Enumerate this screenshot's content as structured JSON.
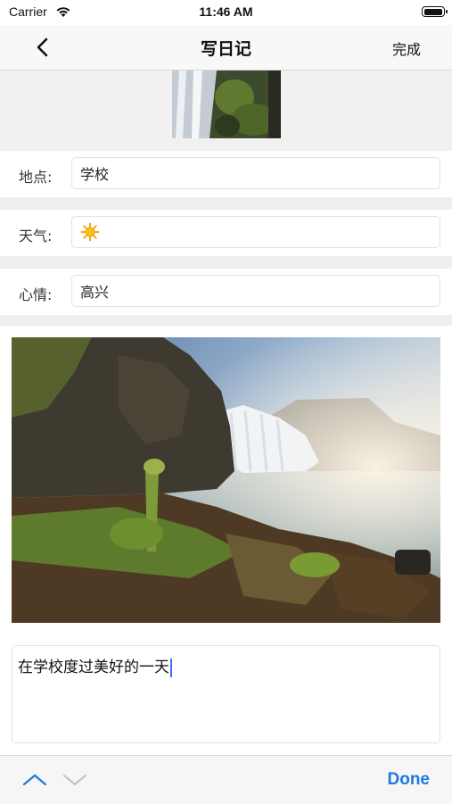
{
  "status_bar": {
    "carrier": "Carrier",
    "time": "11:46 AM"
  },
  "nav": {
    "title": "写日记",
    "done_label": "完成",
    "back_icon": "chevron-left-icon"
  },
  "fields": [
    {
      "label": "地点:",
      "value": "学校"
    },
    {
      "label": "天气:",
      "value": "☀️"
    },
    {
      "label": "心情:",
      "value": "高兴"
    }
  ],
  "diary": {
    "text": "在学校度过美好的一天"
  },
  "keyboard_toolbar": {
    "done_label": "Done",
    "up_icon": "chevron-up-icon",
    "down_icon": "chevron-down-icon"
  },
  "colors": {
    "accent": "#1e78e6",
    "cursor": "#3b6df2"
  }
}
